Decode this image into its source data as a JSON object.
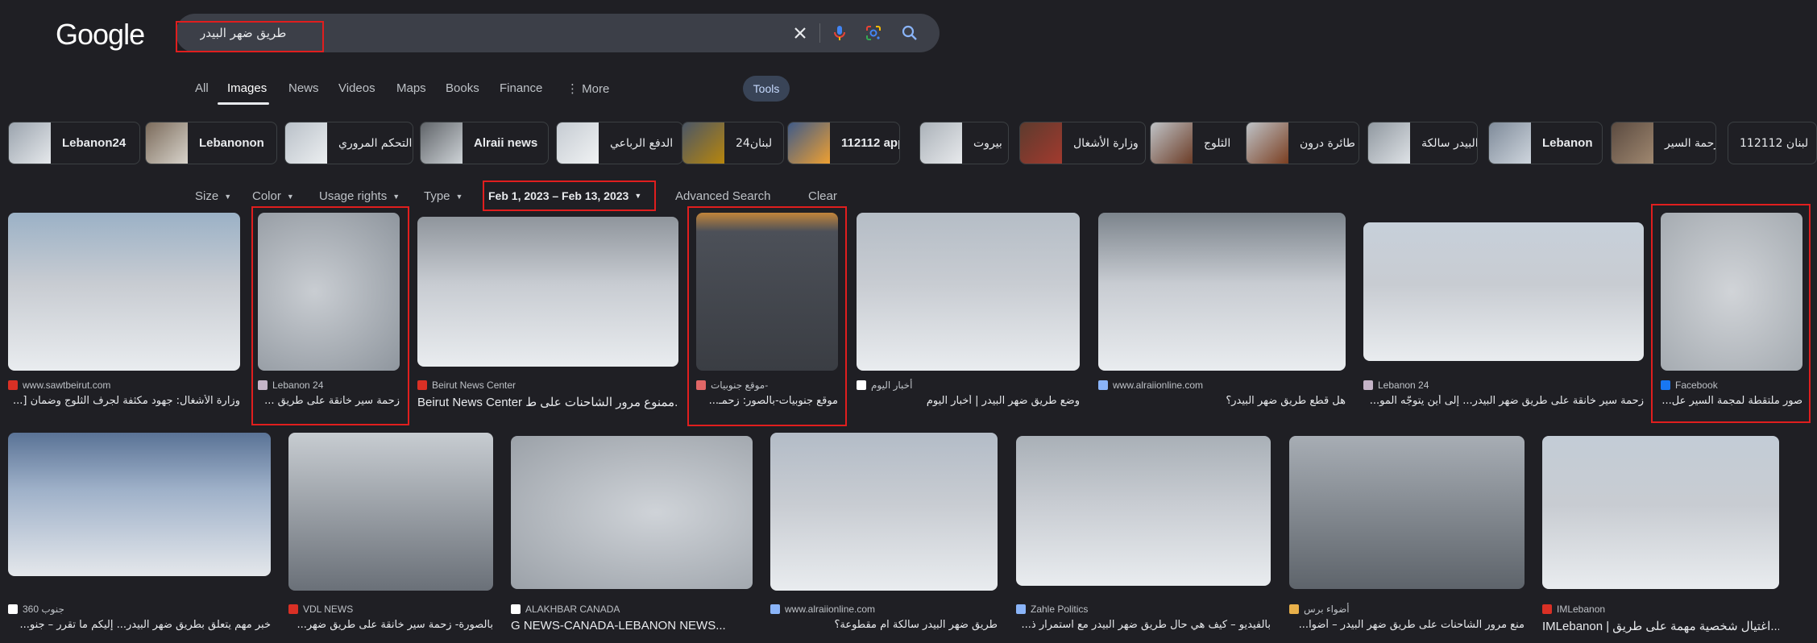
{
  "logo": "Google",
  "search": {
    "query": "طريق ضهر البيدر"
  },
  "tabs": [
    "All",
    "Images",
    "News",
    "Videos",
    "Maps",
    "Books",
    "Finance",
    "⋮ More"
  ],
  "tools_label": "Tools",
  "chips": [
    {
      "label": "Lebanon24",
      "rtl": false
    },
    {
      "label": "Lebanonon",
      "rtl": false
    },
    {
      "label": "التحكم المروري",
      "rtl": true
    },
    {
      "label": "Alraii news",
      "rtl": false
    },
    {
      "label": "الدفع الرباعي",
      "rtl": true
    },
    {
      "label": "لبنان24",
      "rtl": true
    },
    {
      "label": "112112 app",
      "rtl": false
    },
    {
      "label": "بيروت",
      "rtl": true
    },
    {
      "label": "وزارة الأشغال",
      "rtl": true
    },
    {
      "label": "الثلوج",
      "rtl": true
    },
    {
      "label": "طائرة درون",
      "rtl": true
    },
    {
      "label": "البيدر سالكة",
      "rtl": true
    },
    {
      "label": "Lebanon",
      "rtl": false
    },
    {
      "label": "زحمة السير",
      "rtl": true
    },
    {
      "label": "112112 لبنان",
      "rtl": true
    }
  ],
  "filters": {
    "size": "Size",
    "color": "Color",
    "usage": "Usage rights",
    "type": "Type",
    "date": "Feb 1, 2023 – Feb 13, 2023",
    "advanced": "Advanced Search",
    "clear": "Clear"
  },
  "results_row1": [
    {
      "source": "www.sawtbeirut.com",
      "title": "وزارة الأشغال: جهود مكثفة لجرف الثلوج وضمان [...",
      "favicon": "#d93025"
    },
    {
      "source": "Lebanon 24",
      "title": "زحمة سير خانقة على طريق ...",
      "favicon": "#c5b4c8"
    },
    {
      "source": "Beirut News Center",
      "title": "Beirut News Center ممنوع مرور الشاحنات على ط...",
      "favicon": "#d93025"
    },
    {
      "source": "موقع جنوبيات-",
      "title": "موقع جنوبيات-بالصور: زحمـ...",
      "favicon": "#e06666"
    },
    {
      "source": "أخبار اليوم",
      "title": "وضع طريق ضهر البيدر | أخبار اليوم",
      "favicon": "#ffffff"
    },
    {
      "source": "www.alraiionline.com",
      "title": "هل قطع طريق ضهر البيدر؟",
      "favicon": "#8ab4f8"
    },
    {
      "source": "Lebanon 24",
      "title": "زحمة سير خانقة على طريق ضهر البيدر... إلى أين يتوجّه المو...",
      "favicon": "#c5b4c8"
    },
    {
      "source": "Facebook",
      "title": "صور ملتقطة لمجمة السير عل...",
      "favicon": "#1877f2"
    }
  ],
  "results_row2": [
    {
      "source": "جنوب 360",
      "title": "خبر مهم يتعلق بطريق ضهر البيدر... إليكم ما تقرر – جنو...",
      "favicon": "#ffffff"
    },
    {
      "source": "VDL NEWS",
      "title": "بالصورة- زحمة سير خانقة على طريق ضهر...",
      "favicon": "#d93025"
    },
    {
      "source": "ALAKHBAR CANADA",
      "title": "G NEWS-CANADA-LEBANON NEWS...",
      "favicon": "#ffffff"
    },
    {
      "source": "www.alraiionline.com",
      "title": "طريق ضهر البيدر سالكة ام مقطوعة؟",
      "favicon": "#8ab4f8"
    },
    {
      "source": "Zahle Politics",
      "title": "بالفيديو – كيف هي حال طريق ضهر البيدر مع استمرار ذ...",
      "favicon": "#8ab4f8"
    },
    {
      "source": "أضواء برس",
      "title": "منع مرور الشاحنات على طريق ضهر البيدر – أضوا...",
      "favicon": "#e8b04a"
    },
    {
      "source": "IMLebanon",
      "title": "IMLebanon | اغتيال شخصية مهمة على طريق...",
      "favicon": "#d93025"
    }
  ]
}
